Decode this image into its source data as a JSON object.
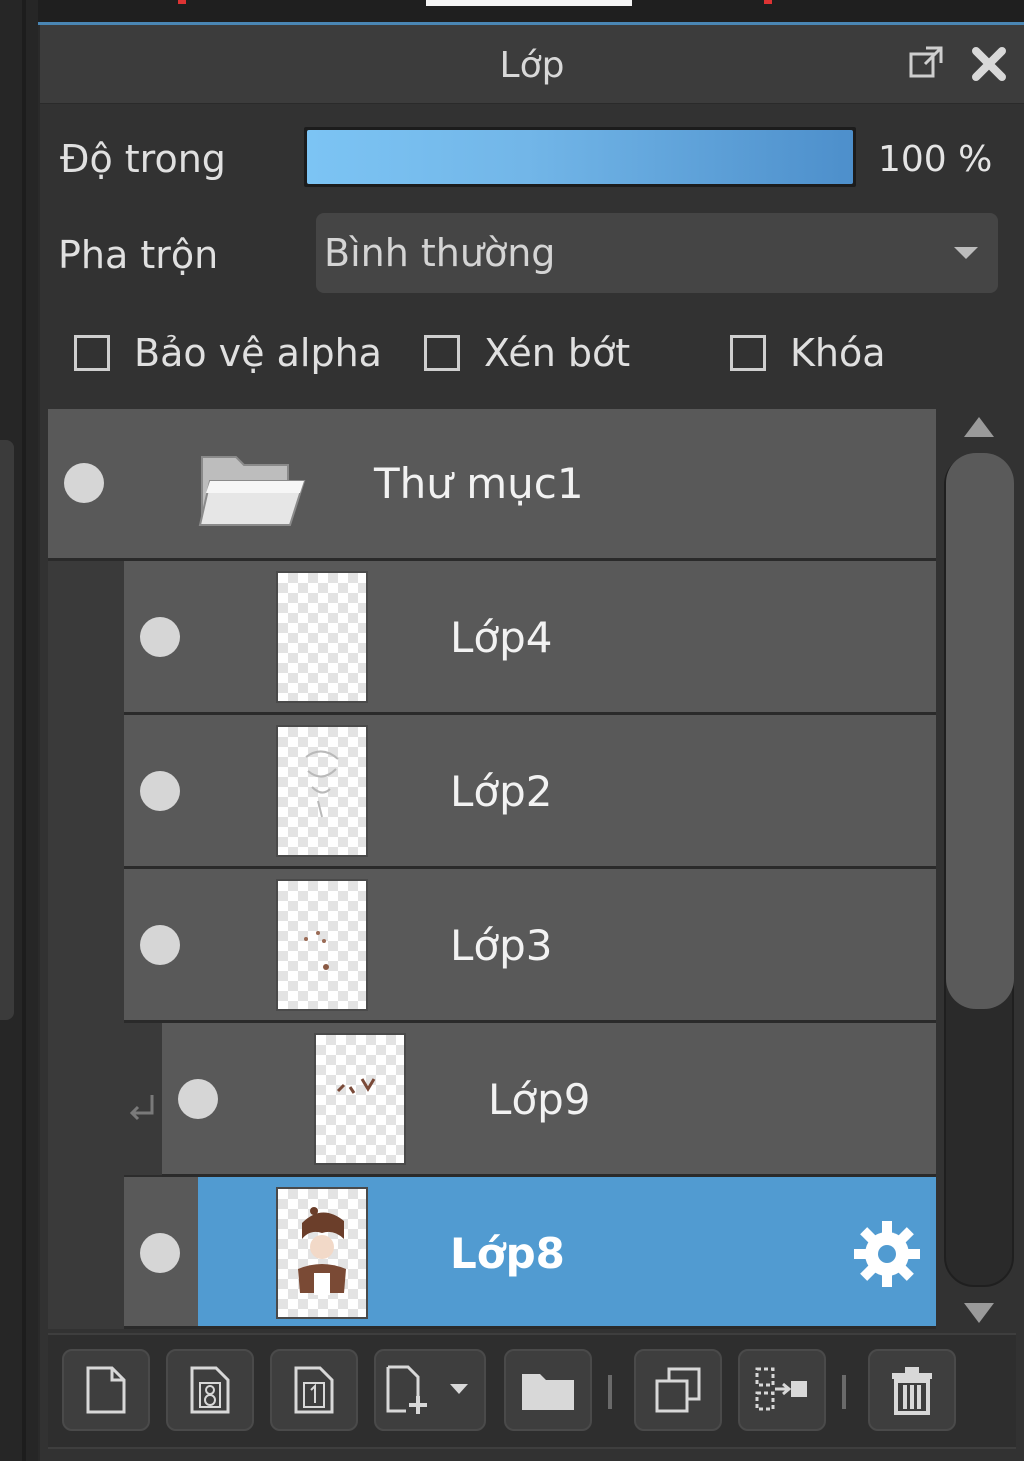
{
  "panel": {
    "title": "Lớp"
  },
  "opacity": {
    "label": "Độ trong",
    "value_text": "100 %",
    "fraction": 1.0
  },
  "blend": {
    "label": "Pha trộn",
    "selected": "Bình thường"
  },
  "options": {
    "protect_alpha": "Bảo vệ alpha",
    "clipping": "Xén bớt",
    "lock": "Khóa"
  },
  "layers": [
    {
      "name": "Thư mục1",
      "type": "folder"
    },
    {
      "name": "Lớp4",
      "type": "layer"
    },
    {
      "name": "Lớp2",
      "type": "layer"
    },
    {
      "name": "Lớp3",
      "type": "layer"
    },
    {
      "name": "Lớp9",
      "type": "layer",
      "clipped": true
    },
    {
      "name": "Lớp8",
      "type": "layer",
      "selected": true
    }
  ],
  "colors": {
    "accent": "#519bd1",
    "slider": "#72b6e8",
    "panel_bg": "#323232",
    "row_bg": "#595959"
  },
  "toolbar_icons": [
    "new-layer-icon",
    "new-8bit-layer-icon",
    "new-1bit-layer-icon",
    "add-layer-dropdown-icon",
    "new-folder-icon",
    "duplicate-layer-icon",
    "merge-down-icon",
    "delete-layer-icon"
  ]
}
